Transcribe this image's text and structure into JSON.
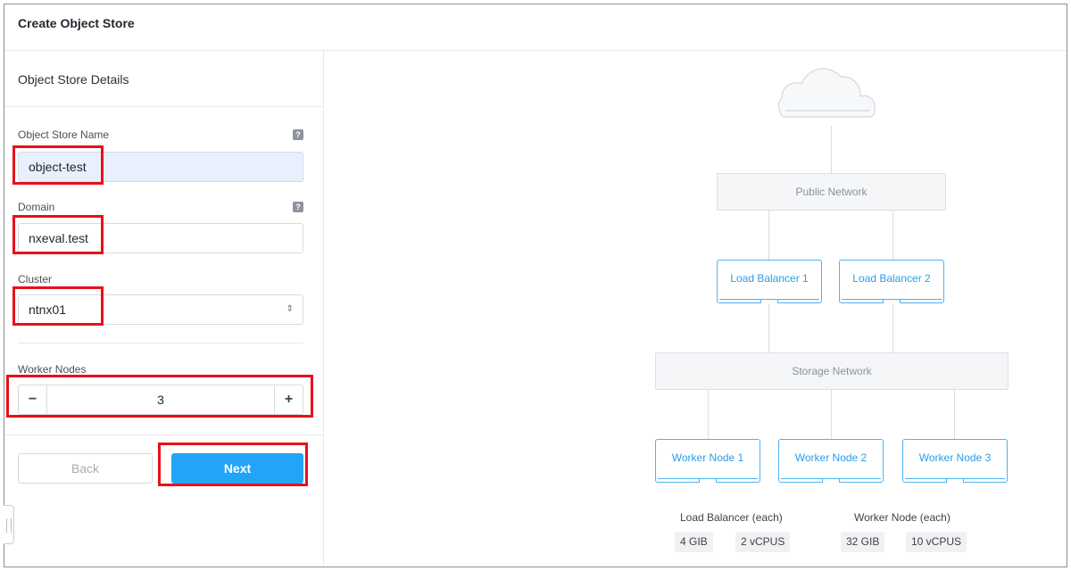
{
  "header": {
    "title": "Create Object Store"
  },
  "form": {
    "section_title": "Object Store Details",
    "help_glyph": "?",
    "object_store_name": {
      "label": "Object Store Name",
      "value": "object-test"
    },
    "domain": {
      "label": "Domain",
      "value": "nxeval.test"
    },
    "cluster": {
      "label": "Cluster",
      "value": "ntnx01",
      "arrows": "⇕"
    },
    "worker_nodes": {
      "label": "Worker Nodes",
      "value": "3",
      "minus": "−",
      "plus": "+"
    },
    "back_label": "Back",
    "next_label": "Next"
  },
  "diagram": {
    "public_network": "Public Network",
    "storage_network": "Storage Network",
    "load_balancers": [
      "Load Balancer 1",
      "Load Balancer 2"
    ],
    "worker_nodes": [
      "Worker Node 1",
      "Worker Node 2",
      "Worker Node 3"
    ],
    "specs": {
      "load_balancer": {
        "title": "Load Balancer (each)",
        "memory": "4 GIB",
        "cpu": "2 vCPUS"
      },
      "worker_node": {
        "title": "Worker Node (each)",
        "memory": "32 GIB",
        "cpu": "10 vCPUS"
      }
    }
  },
  "colors": {
    "accent": "#22a5f7",
    "highlight": "#e8101a",
    "node_border": "#4fb3f0"
  }
}
